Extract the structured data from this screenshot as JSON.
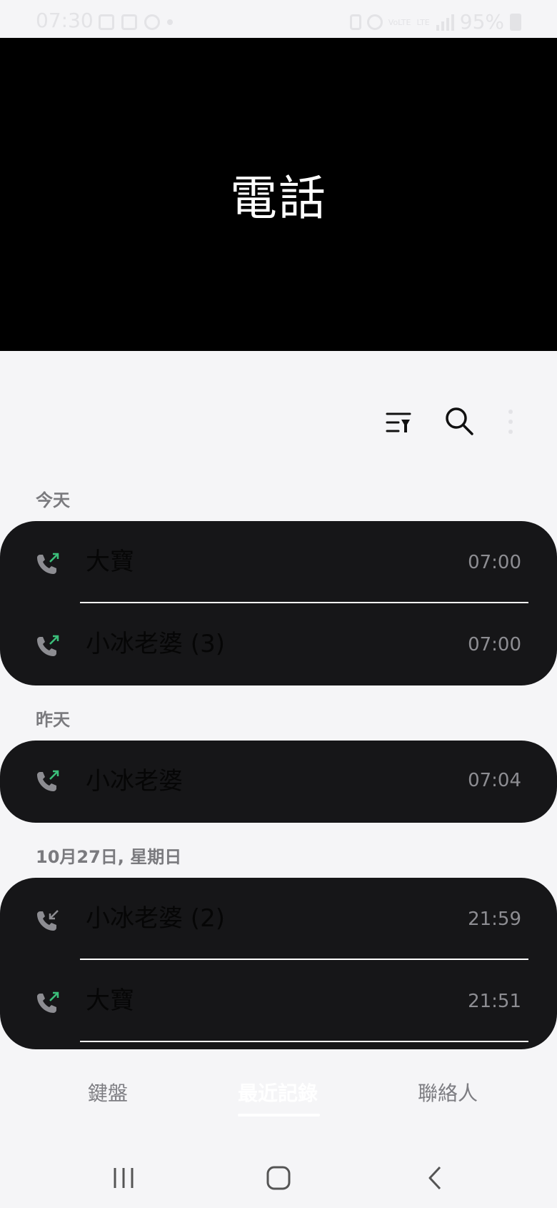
{
  "status_bar": {
    "time": "07:30",
    "battery": "95%",
    "signal_label_1": "VoLTE",
    "signal_label_2": "LTE"
  },
  "header": {
    "title": "電話"
  },
  "toolbar": {
    "icons": [
      "filter-icon",
      "search-icon",
      "more-vert-icon"
    ]
  },
  "sections": [
    {
      "label": "今天",
      "calls": [
        {
          "name": "大寶",
          "time": "07:00",
          "type": "outgoing"
        },
        {
          "name": "小冰老婆 (3)",
          "time": "07:00",
          "type": "outgoing"
        }
      ]
    },
    {
      "label": "昨天",
      "calls": [
        {
          "name": "小冰老婆",
          "time": "07:04",
          "type": "outgoing"
        }
      ]
    },
    {
      "label": "10月27日, 星期日",
      "calls": [
        {
          "name": "小冰老婆 (2)",
          "time": "21:59",
          "type": "incoming"
        },
        {
          "name": "大寶",
          "time": "21:51",
          "type": "outgoing"
        }
      ]
    }
  ],
  "tabs": {
    "keypad": "鍵盤",
    "recents": "最近記錄",
    "contacts": "聯絡人"
  },
  "colors": {
    "outgoing_arrow": "#3bbf7a",
    "incoming_arrow": "#8d8d92",
    "card_bg": "#161618",
    "header_bg": "#000000"
  }
}
